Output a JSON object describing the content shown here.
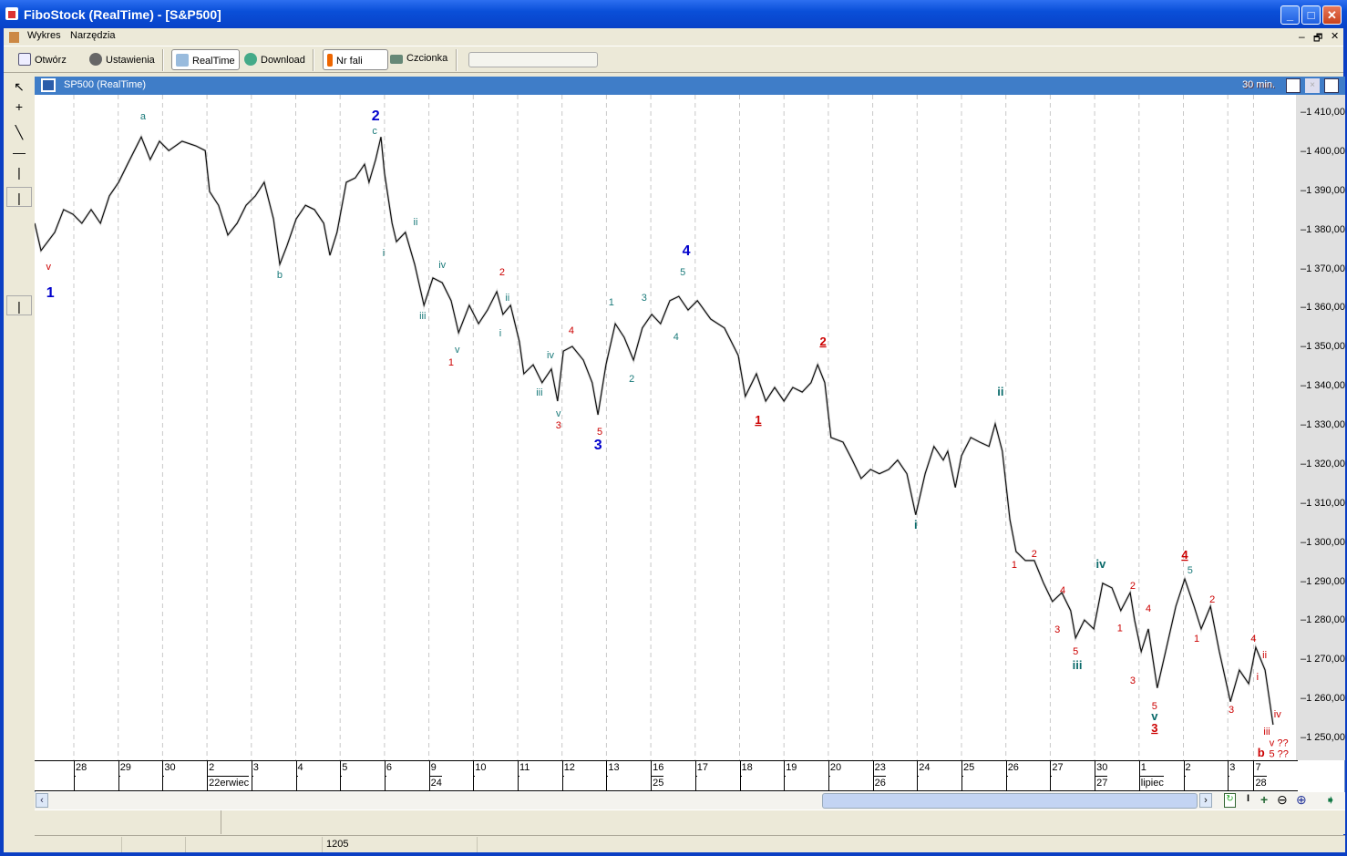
{
  "window": {
    "title": "FiboStock (RealTime) - [S&P500]",
    "minimize": "_",
    "maximize": "□",
    "close": "✕"
  },
  "menu": [
    "Wykres",
    "Narzędzia"
  ],
  "toolbar": {
    "open": "Otwórz",
    "settings": "Ustawienia",
    "realtime": "RealTime",
    "download": "Download",
    "wave_no": "Nr fali",
    "font": "Czcionka"
  },
  "chart_window": {
    "title": "SP500 (RealTime)",
    "interval": "30 min."
  },
  "colors": {
    "red": "#cc0000",
    "teal": "#1a7a7a",
    "blue": "#0000cc"
  },
  "y_ticks": [
    "1 410,00",
    "1 400,00",
    "1 390,00",
    "1 380,00",
    "1 370,00",
    "1 360,00",
    "1 350,00",
    "1 340,00",
    "1 330,00",
    "1 320,00",
    "1 310,00",
    "1 300,00",
    "1 290,00",
    "1 280,00",
    "1 270,00",
    "1 260,00",
    "1 250,00"
  ],
  "days": [
    "28",
    "29",
    "30",
    "2",
    "3",
    "4",
    "5",
    "6",
    "9",
    "10",
    "11",
    "12",
    "13",
    "16",
    "17",
    "18",
    "19",
    "20",
    "23",
    "24",
    "25",
    "26",
    "27",
    "30",
    "1",
    "2",
    "3",
    "7"
  ],
  "weeks": [
    {
      "i": 3,
      "label": "22erwiec"
    },
    {
      "i": 8,
      "label": "24"
    },
    {
      "i": 13,
      "label": "25"
    },
    {
      "i": 18,
      "label": "26"
    },
    {
      "i": 23,
      "label": "27"
    },
    {
      "i": 24,
      "label": "lipiec"
    },
    {
      "i": 27,
      "label": "28"
    }
  ],
  "status": {
    "value": "1205"
  },
  "chart_data": {
    "type": "line",
    "title": "SP500 (RealTime)",
    "interval": "30 min.",
    "ylim": [
      1245,
      1412
    ],
    "xunit": "trading day index (0 = first day 28)",
    "series": [
      {
        "name": "SP500",
        "points": [
          [
            -0.88,
            1381.8
          ],
          [
            -0.74,
            1374.8
          ],
          [
            -0.43,
            1379.5
          ],
          [
            -0.23,
            1385.3
          ],
          [
            -0.02,
            1384.1
          ],
          [
            0.18,
            1381.8
          ],
          [
            0.39,
            1385.3
          ],
          [
            0.6,
            1381.8
          ],
          [
            0.8,
            1388.8
          ],
          [
            1.01,
            1392.3
          ],
          [
            1.21,
            1396.9
          ],
          [
            1.52,
            1403.9
          ],
          [
            1.72,
            1398.1
          ],
          [
            1.93,
            1402.8
          ],
          [
            2.14,
            1400.4
          ],
          [
            2.44,
            1402.8
          ],
          [
            2.75,
            1401.6
          ],
          [
            2.96,
            1400.4
          ],
          [
            3.06,
            1389.9
          ],
          [
            3.26,
            1386.4
          ],
          [
            3.47,
            1378.8
          ],
          [
            3.68,
            1381.8
          ],
          [
            3.88,
            1386.4
          ],
          [
            4.09,
            1388.8
          ],
          [
            4.29,
            1392.3
          ],
          [
            4.5,
            1382.9
          ],
          [
            4.64,
            1371.3
          ],
          [
            4.8,
            1376
          ],
          [
            5.01,
            1382.9
          ],
          [
            5.22,
            1386.4
          ],
          [
            5.42,
            1385.3
          ],
          [
            5.63,
            1381.8
          ],
          [
            5.77,
            1373.6
          ],
          [
            5.93,
            1379.5
          ],
          [
            6.14,
            1392.3
          ],
          [
            6.34,
            1393.4
          ],
          [
            6.55,
            1396.9
          ],
          [
            6.65,
            1392.3
          ],
          [
            6.8,
            1398.1
          ],
          [
            6.92,
            1403.9
          ],
          [
            7,
            1394.6
          ],
          [
            7.17,
            1381.8
          ],
          [
            7.27,
            1377.1
          ],
          [
            7.47,
            1379.5
          ],
          [
            7.68,
            1371.3
          ],
          [
            7.89,
            1360.8
          ],
          [
            8.09,
            1367.8
          ],
          [
            8.3,
            1366.6
          ],
          [
            8.5,
            1362
          ],
          [
            8.67,
            1353.8
          ],
          [
            8.91,
            1360.8
          ],
          [
            9.12,
            1356.1
          ],
          [
            9.32,
            1359.6
          ],
          [
            9.53,
            1364.3
          ],
          [
            9.67,
            1358.5
          ],
          [
            9.84,
            1360.8
          ],
          [
            10.04,
            1351.5
          ],
          [
            10.14,
            1343.3
          ],
          [
            10.35,
            1345.6
          ],
          [
            10.55,
            1341
          ],
          [
            10.76,
            1344.5
          ],
          [
            10.9,
            1336.3
          ],
          [
            11.03,
            1349.1
          ],
          [
            11.23,
            1350.3
          ],
          [
            11.48,
            1346.8
          ],
          [
            11.68,
            1341
          ],
          [
            11.81,
            1332.8
          ],
          [
            11.99,
            1345.6
          ],
          [
            12.2,
            1356.1
          ],
          [
            12.4,
            1352.6
          ],
          [
            12.61,
            1346.8
          ],
          [
            12.81,
            1355
          ],
          [
            13.02,
            1358.5
          ],
          [
            13.22,
            1356.1
          ],
          [
            13.43,
            1362
          ],
          [
            13.63,
            1363.1
          ],
          [
            13.84,
            1359.6
          ],
          [
            14.05,
            1362
          ],
          [
            14.35,
            1357.3
          ],
          [
            14.66,
            1355
          ],
          [
            14.97,
            1348
          ],
          [
            15.13,
            1337.5
          ],
          [
            15.38,
            1343.3
          ],
          [
            15.59,
            1336.3
          ],
          [
            15.79,
            1339.8
          ],
          [
            16,
            1336.3
          ],
          [
            16.2,
            1339.8
          ],
          [
            16.41,
            1338.6
          ],
          [
            16.61,
            1341
          ],
          [
            16.76,
            1345.6
          ],
          [
            16.92,
            1341
          ],
          [
            17.06,
            1327
          ],
          [
            17.33,
            1325.8
          ],
          [
            17.54,
            1321.2
          ],
          [
            17.74,
            1316.5
          ],
          [
            17.95,
            1318.8
          ],
          [
            18.15,
            1317.7
          ],
          [
            18.36,
            1318.8
          ],
          [
            18.56,
            1321.2
          ],
          [
            18.77,
            1317.7
          ],
          [
            18.97,
            1307.2
          ],
          [
            19.18,
            1317.7
          ],
          [
            19.38,
            1324.7
          ],
          [
            19.59,
            1321.2
          ],
          [
            19.69,
            1323.5
          ],
          [
            19.86,
            1314.2
          ],
          [
            20,
            1322.3
          ],
          [
            20.21,
            1327
          ],
          [
            20.41,
            1325.8
          ],
          [
            20.62,
            1324.7
          ],
          [
            20.76,
            1330.5
          ],
          [
            20.92,
            1323.5
          ],
          [
            21.09,
            1306
          ],
          [
            21.23,
            1297.8
          ],
          [
            21.44,
            1295.5
          ],
          [
            21.64,
            1295.5
          ],
          [
            21.85,
            1289.7
          ],
          [
            22.05,
            1285
          ],
          [
            22.26,
            1287.3
          ],
          [
            22.46,
            1282.7
          ],
          [
            22.57,
            1275.7
          ],
          [
            22.77,
            1280.3
          ],
          [
            22.98,
            1278
          ],
          [
            23.18,
            1289.7
          ],
          [
            23.39,
            1288.5
          ],
          [
            23.59,
            1282.7
          ],
          [
            23.8,
            1287.3
          ],
          [
            23.9,
            1280.3
          ],
          [
            24.05,
            1272.2
          ],
          [
            24.21,
            1278
          ],
          [
            24.41,
            1262.9
          ],
          [
            24.62,
            1273.3
          ],
          [
            24.83,
            1283.8
          ],
          [
            25.03,
            1290.8
          ],
          [
            25.24,
            1283.8
          ],
          [
            25.4,
            1278
          ],
          [
            25.61,
            1283.8
          ],
          [
            25.81,
            1272.2
          ],
          [
            26.06,
            1259.4
          ],
          [
            26.26,
            1267.5
          ],
          [
            26.47,
            1264
          ],
          [
            26.63,
            1273.3
          ],
          [
            26.84,
            1267.5
          ],
          [
            27.02,
            1253.5
          ]
        ]
      }
    ],
    "annotations": [
      {
        "t": "v",
        "x": -0.57,
        "y": 1370.8,
        "c": "red",
        "s": "sm"
      },
      {
        "t": "1",
        "x": -0.53,
        "y": 1363.8,
        "c": "blue",
        "s": "big"
      },
      {
        "t": "a",
        "x": 1.56,
        "y": 1409.3,
        "c": "teal",
        "s": "sm"
      },
      {
        "t": "2",
        "x": 6.8,
        "y": 1409.1,
        "c": "blue",
        "s": "big"
      },
      {
        "t": "c",
        "x": 6.78,
        "y": 1405.6,
        "c": "teal",
        "s": "sm"
      },
      {
        "t": "b",
        "x": 4.64,
        "y": 1368.7,
        "c": "teal",
        "s": "sm"
      },
      {
        "t": "ii",
        "x": 7.7,
        "y": 1382.3,
        "c": "teal",
        "s": "sm"
      },
      {
        "t": "i",
        "x": 6.98,
        "y": 1374.3,
        "c": "teal",
        "s": "sm"
      },
      {
        "t": "iv",
        "x": 8.3,
        "y": 1371.3,
        "c": "teal",
        "s": "sm"
      },
      {
        "t": "iii",
        "x": 7.86,
        "y": 1358.2,
        "c": "teal",
        "s": "sm"
      },
      {
        "t": "v",
        "x": 8.64,
        "y": 1349.6,
        "c": "teal",
        "s": "sm"
      },
      {
        "t": "1",
        "x": 8.5,
        "y": 1346.3,
        "c": "red",
        "s": "sm"
      },
      {
        "t": "2",
        "x": 9.65,
        "y": 1369.4,
        "c": "red",
        "s": "sm"
      },
      {
        "t": "ii",
        "x": 9.77,
        "y": 1362.9,
        "c": "teal",
        "s": "sm"
      },
      {
        "t": "i",
        "x": 9.61,
        "y": 1353.8,
        "c": "teal",
        "s": "sm"
      },
      {
        "t": "iv",
        "x": 10.74,
        "y": 1348.2,
        "c": "teal",
        "s": "sm"
      },
      {
        "t": "iii",
        "x": 10.49,
        "y": 1338.6,
        "c": "teal",
        "s": "sm"
      },
      {
        "t": "v",
        "x": 10.92,
        "y": 1333.3,
        "c": "teal",
        "s": "sm"
      },
      {
        "t": "3",
        "x": 10.92,
        "y": 1330.2,
        "c": "red",
        "s": "sm"
      },
      {
        "t": "4",
        "x": 11.21,
        "y": 1354.5,
        "c": "red",
        "s": "sm"
      },
      {
        "t": "5",
        "x": 11.85,
        "y": 1328.6,
        "c": "red",
        "s": "sm"
      },
      {
        "t": "3",
        "x": 11.81,
        "y": 1324.9,
        "c": "blue",
        "s": "big"
      },
      {
        "t": "1",
        "x": 12.11,
        "y": 1361.7,
        "c": "teal",
        "s": "sm"
      },
      {
        "t": "2",
        "x": 12.57,
        "y": 1342.1,
        "c": "teal",
        "s": "sm"
      },
      {
        "t": "3",
        "x": 12.85,
        "y": 1362.9,
        "c": "teal",
        "s": "sm"
      },
      {
        "t": "4",
        "x": 13.57,
        "y": 1352.9,
        "c": "teal",
        "s": "sm"
      },
      {
        "t": "5",
        "x": 13.72,
        "y": 1369.4,
        "c": "teal",
        "s": "sm"
      },
      {
        "t": "4",
        "x": 13.8,
        "y": 1374.6,
        "c": "blue",
        "s": "big"
      },
      {
        "t": "2",
        "x": 16.88,
        "y": 1351.5,
        "c": "red",
        "s": "ul"
      },
      {
        "t": "1",
        "x": 15.42,
        "y": 1331.4,
        "c": "red",
        "s": "ul"
      },
      {
        "t": "ii",
        "x": 20.88,
        "y": 1338.6,
        "c": "teal",
        "s": "bold"
      },
      {
        "t": "i",
        "x": 18.97,
        "y": 1304.6,
        "c": "teal",
        "s": "bold"
      },
      {
        "t": "1",
        "x": 21.19,
        "y": 1294.6,
        "c": "red",
        "s": "sm"
      },
      {
        "t": "2",
        "x": 21.64,
        "y": 1297.4,
        "c": "red",
        "s": "sm"
      },
      {
        "t": "4",
        "x": 22.28,
        "y": 1288,
        "c": "red",
        "s": "sm"
      },
      {
        "t": "3",
        "x": 22.16,
        "y": 1278,
        "c": "red",
        "s": "sm"
      },
      {
        "t": "5",
        "x": 22.57,
        "y": 1272.4,
        "c": "red",
        "s": "sm"
      },
      {
        "t": "iii",
        "x": 22.61,
        "y": 1268.7,
        "c": "teal",
        "s": "bold"
      },
      {
        "t": "iv",
        "x": 23.14,
        "y": 1294.6,
        "c": "teal",
        "s": "bold"
      },
      {
        "t": "2",
        "x": 23.86,
        "y": 1289.2,
        "c": "red",
        "s": "sm"
      },
      {
        "t": "1",
        "x": 23.57,
        "y": 1278.3,
        "c": "red",
        "s": "sm"
      },
      {
        "t": "4",
        "x": 24.21,
        "y": 1283.4,
        "c": "red",
        "s": "sm"
      },
      {
        "t": "3",
        "x": 23.86,
        "y": 1264.9,
        "c": "red",
        "s": "sm"
      },
      {
        "t": "5",
        "x": 24.35,
        "y": 1258.4,
        "c": "red",
        "s": "sm"
      },
      {
        "t": "v",
        "x": 24.35,
        "y": 1255.6,
        "c": "teal",
        "s": "bold"
      },
      {
        "t": "3",
        "x": 24.35,
        "y": 1252.6,
        "c": "red",
        "s": "ul"
      },
      {
        "t": "4",
        "x": 25.03,
        "y": 1296.9,
        "c": "red",
        "s": "ul"
      },
      {
        "t": "5",
        "x": 25.15,
        "y": 1293.2,
        "c": "teal",
        "s": "sm"
      },
      {
        "t": "2",
        "x": 25.65,
        "y": 1285.7,
        "c": "red",
        "s": "sm"
      },
      {
        "t": "1",
        "x": 25.3,
        "y": 1275.7,
        "c": "red",
        "s": "sm"
      },
      {
        "t": "3",
        "x": 26.08,
        "y": 1257.5,
        "c": "red",
        "s": "sm"
      },
      {
        "t": "4",
        "x": 26.58,
        "y": 1275.7,
        "c": "red",
        "s": "sm"
      },
      {
        "t": "ii",
        "x": 26.83,
        "y": 1271.5,
        "c": "red",
        "s": "sm"
      },
      {
        "t": "i",
        "x": 26.67,
        "y": 1265.9,
        "c": "red",
        "s": "sm"
      },
      {
        "t": "iv",
        "x": 27.12,
        "y": 1256.3,
        "c": "red",
        "s": "sm"
      },
      {
        "t": "iii",
        "x": 26.88,
        "y": 1251.9,
        "c": "red",
        "s": "sm"
      },
      {
        "t": "v ??",
        "x": 27.15,
        "y": 1248.9,
        "c": "red",
        "s": "sm"
      },
      {
        "t": "b",
        "x": 26.75,
        "y": 1246.3,
        "c": "red",
        "s": "bold"
      },
      {
        "t": "5 ??",
        "x": 27.15,
        "y": 1246.1,
        "c": "red",
        "s": "sm"
      }
    ]
  }
}
